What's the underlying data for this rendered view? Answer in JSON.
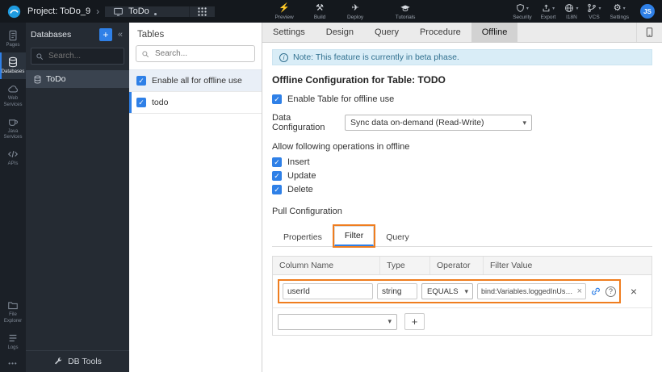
{
  "colors": {
    "accent": "#2f80e7",
    "annotation": "#ef7d1f",
    "note_bg": "#d9edf7",
    "note_text": "#31708f"
  },
  "icons": {
    "chevron_right": "›",
    "caret_down": "▾",
    "collapse_left": "«",
    "plus": "+",
    "close": "×",
    "help": "?",
    "info_i": "i",
    "preview_glyph": "⚡",
    "build_glyph": "⚒",
    "deploy_glyph": "✈",
    "gear_glyph": "⚙"
  },
  "top_bar": {
    "project_label": "Project: ToDo_9",
    "page_tab_label": "ToDo",
    "actions": [
      {
        "label": "Preview"
      },
      {
        "label": "Build"
      },
      {
        "label": "Deploy"
      },
      {
        "label": "Tutorials"
      }
    ],
    "right_actions": [
      {
        "label": "Security"
      },
      {
        "label": "Export"
      },
      {
        "label": "I18N"
      },
      {
        "label": "VCS"
      },
      {
        "label": "Settings"
      }
    ],
    "avatar_initials": "JS"
  },
  "rail": {
    "items": [
      {
        "label": "Pages"
      },
      {
        "label": "Databases"
      },
      {
        "label": "Web Services"
      },
      {
        "label": "Java Services"
      },
      {
        "label": "APIs"
      }
    ],
    "bottom_items": [
      {
        "label": "File Explorer"
      },
      {
        "label": "Logs"
      }
    ],
    "overflow": "•••"
  },
  "db_panel": {
    "title": "Databases",
    "search_placeholder": "Search...",
    "items": [
      {
        "label": "ToDo"
      }
    ],
    "footer": "DB Tools"
  },
  "tables_panel": {
    "title": "Tables",
    "search_placeholder": "Search...",
    "enable_all_label": "Enable all for offline use",
    "tables": [
      {
        "label": "todo"
      }
    ]
  },
  "tabs": [
    "Settings",
    "Design",
    "Query",
    "Procedure",
    "Offline"
  ],
  "active_tab": "Offline",
  "offline": {
    "note": "Note: This feature is currently in beta phase.",
    "heading": "Offline Configuration for Table: TODO",
    "enable_table_label": "Enable Table for offline use",
    "data_config_label": "Data Configuration",
    "data_config_value": "Sync data on-demand (Read-Write)",
    "operations_label": "Allow following operations in offline",
    "operations": [
      "Insert",
      "Update",
      "Delete"
    ],
    "pull_label": "Pull Configuration",
    "sub_tabs": [
      "Properties",
      "Filter",
      "Query"
    ],
    "active_sub_tab": "Filter",
    "filter_table": {
      "headers": [
        "Column Name",
        "Type",
        "Operator",
        "Filter Value"
      ],
      "row": {
        "column_name": "userId",
        "type": "string",
        "operator": "EQUALS",
        "filter_value": "bind:Variables.loggedInUser.data"
      },
      "add_label": "+"
    }
  }
}
